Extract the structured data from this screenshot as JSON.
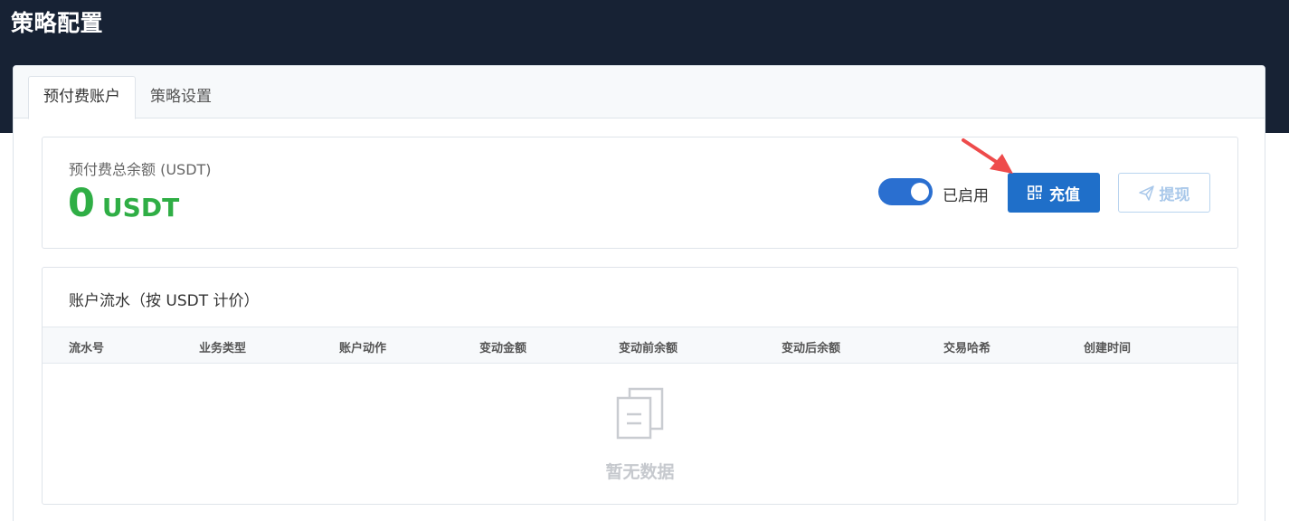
{
  "page": {
    "title": "策略配置"
  },
  "tabs": [
    {
      "label": "预付费账户",
      "active": true
    },
    {
      "label": "策略设置",
      "active": false
    }
  ],
  "balance": {
    "label": "预付费总余额 (USDT)",
    "value": "0",
    "unit": "USDT"
  },
  "toggle": {
    "label": "已启用",
    "enabled": true
  },
  "buttons": {
    "recharge": "充值",
    "withdraw": "提现"
  },
  "ledger": {
    "title": "账户流水（按 USDT 计价）",
    "columns": [
      "流水号",
      "业务类型",
      "账户动作",
      "变动金额",
      "变动前余额",
      "变动后余额",
      "交易哈希",
      "创建时间"
    ],
    "rows": [],
    "empty_text": "暂无数据"
  },
  "colors": {
    "header_bg": "#172234",
    "primary": "#1f6fc9",
    "balance_green": "#2fae45",
    "annotation_arrow": "#ee4b4b"
  },
  "icons": {
    "recharge": "qr-code-icon",
    "withdraw": "paper-plane-icon",
    "empty": "empty-documents-icon"
  }
}
